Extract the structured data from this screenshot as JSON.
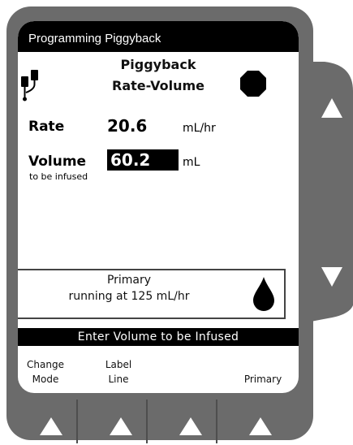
{
  "colors": {
    "housing": "#6b6b6b",
    "screen": "#ffffff",
    "bar": "#000000",
    "arrow": "#ffffff"
  },
  "title_bar": {
    "title": "Programming Piggyback"
  },
  "heading": {
    "line1": "Piggyback",
    "line2": "Rate-Volume"
  },
  "icons": {
    "bags": "iv-bags-icon",
    "stop": "stop-octagon-icon",
    "drop": "drop-icon"
  },
  "rate": {
    "label": "Rate",
    "value": "20.6",
    "unit": "mL/hr"
  },
  "volume": {
    "label": "Volume",
    "value": "60.2",
    "unit": "mL",
    "sub_label": "to be infused"
  },
  "primary": {
    "line1": "Primary",
    "line2": "running at 125 mL/hr"
  },
  "prompt": "Enter Volume to be Infused",
  "softkeys": [
    {
      "line1": "Change",
      "line2": "Mode"
    },
    {
      "line1": "Label",
      "line2": "Line"
    },
    {
      "line1": "",
      "line2": ""
    },
    {
      "line1": "Primary",
      "line2": ""
    }
  ]
}
